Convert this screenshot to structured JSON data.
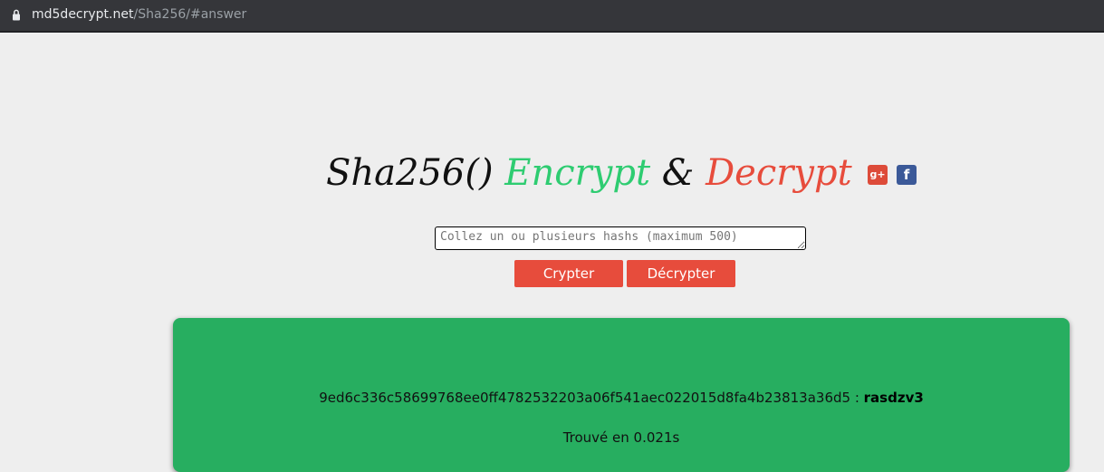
{
  "browser": {
    "url_host": "md5decrypt.net",
    "url_path": "/Sha256/#answer"
  },
  "header": {
    "title_part1": "Sha256()",
    "title_part2": "Encrypt",
    "title_part3": "&",
    "title_part4": "Decrypt",
    "social": {
      "gplus_glyph": "g+",
      "facebook_glyph": "f"
    }
  },
  "form": {
    "hash_input_placeholder": "Collez un ou plusieurs hashs (maximum 500)",
    "hash_input_value": "",
    "crypt_button": "Crypter",
    "decrypt_button": "Décrypter"
  },
  "result": {
    "hash": "9ed6c336c58699768ee0ff4782532203a06f541aec022015d8fa4b23813a36d5",
    "separator": " : ",
    "answer": "rasdzv3",
    "time_text": "Trouvé en 0.021s"
  },
  "colors": {
    "page_bg": "#eeeeee",
    "green_accent": "#2ecc71",
    "red_accent": "#e74c3c",
    "result_bg": "#27ae60"
  }
}
